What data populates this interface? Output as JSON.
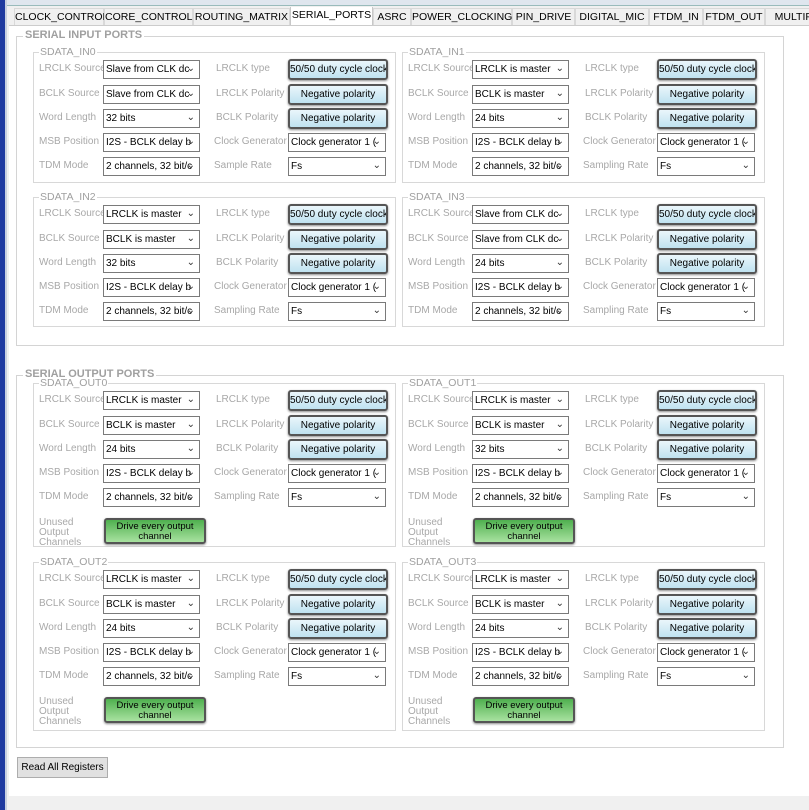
{
  "tabs": [
    "CLOCK_CONTROL",
    "CORE_CONTROL",
    "ROUTING_MATRIX",
    "SERIAL_PORTS",
    "ASRC",
    "POWER_CLOCKING",
    "PIN_DRIVE",
    "DIGITAL_MIC",
    "FTDM_IN",
    "FTDM_OUT",
    "MULTIPI"
  ],
  "active_tab": "SERIAL_PORTS",
  "labels": {
    "lrclk_source": "LRCLK Source",
    "bclk_source": "BCLK Source",
    "word_length": "Word Length",
    "msb_position": "MSB Position",
    "tdm_mode": "TDM Mode",
    "lrclk_type": "LRCLK type",
    "lrclk_polarity": "LRCLK Polarity",
    "bclk_polarity": "BCLK Polarity",
    "clock_generator": "Clock Generator",
    "unused_output": "Unused Output Channels"
  },
  "input_section": {
    "title": "SERIAL INPUT PORTS",
    "groups": [
      {
        "name": "SDATA_IN0",
        "lrclk_source": "Slave from CLK dc",
        "bclk_source": "Slave from CLK dc",
        "word_length": "32 bits",
        "msb_position": "I2S - BCLK delay b",
        "tdm_mode": "2 channels, 32 bit/c",
        "lrclk_type": "50/50 duty cycle clock",
        "lrclk_polarity": "Negative polarity",
        "bclk_polarity": "Negative polarity",
        "clock_generator": "Clock generator 1 (",
        "rate_label": "Sample Rate",
        "rate": "Fs"
      },
      {
        "name": "SDATA_IN1",
        "lrclk_source": "LRCLK is master",
        "bclk_source": "BCLK is master",
        "word_length": "24 bits",
        "msb_position": "I2S - BCLK delay b",
        "tdm_mode": "2 channels, 32 bit/c",
        "lrclk_type": "50/50 duty cycle clock",
        "lrclk_polarity": "Negative polarity",
        "bclk_polarity": "Negative polarity",
        "clock_generator": "Clock generator 1 (",
        "rate_label": "Sampling Rate",
        "rate": "Fs"
      },
      {
        "name": "SDATA_IN2",
        "lrclk_source": "LRCLK is master",
        "bclk_source": "BCLK is master",
        "word_length": "32 bits",
        "msb_position": "I2S - BCLK delay b",
        "tdm_mode": "2 channels, 32 bit/c",
        "lrclk_type": "50/50 duty cycle clock",
        "lrclk_polarity": "Negative polarity",
        "bclk_polarity": "Negative polarity",
        "clock_generator": "Clock generator 1 (",
        "rate_label": "Sampling Rate",
        "rate": "Fs"
      },
      {
        "name": "SDATA_IN3",
        "lrclk_source": "Slave from CLK dc",
        "bclk_source": "Slave from CLK dc",
        "word_length": "24 bits",
        "msb_position": "I2S - BCLK delay b",
        "tdm_mode": "2 channels, 32 bit/c",
        "lrclk_type": "50/50 duty cycle clock",
        "lrclk_polarity": "Negative polarity",
        "bclk_polarity": "Negative polarity",
        "clock_generator": "Clock generator 1 (",
        "rate_label": "Sampling Rate",
        "rate": "Fs"
      }
    ]
  },
  "output_section": {
    "title": "SERIAL OUTPUT PORTS",
    "groups": [
      {
        "name": "SDATA_OUT0",
        "lrclk_source": "LRCLK is master",
        "bclk_source": "BCLK is master",
        "word_length": "24 bits",
        "msb_position": "I2S - BCLK delay b",
        "tdm_mode": "2 channels, 32 bit/c",
        "lrclk_type": "50/50 duty cycle clock",
        "lrclk_polarity": "Negative polarity",
        "bclk_polarity": "Negative polarity",
        "clock_generator": "Clock generator 1 (",
        "rate_label": "Sampling Rate",
        "rate": "Fs",
        "unused_output": "Drive every output channel"
      },
      {
        "name": "SDATA_OUT1",
        "lrclk_source": "LRCLK is master",
        "bclk_source": "BCLK is master",
        "word_length": "32 bits",
        "msb_position": "I2S - BCLK delay b",
        "tdm_mode": "2 channels, 32 bit/c",
        "lrclk_type": "50/50 duty cycle clock",
        "lrclk_polarity": "Negative polarity",
        "bclk_polarity": "Negative polarity",
        "clock_generator": "Clock generator 1 (",
        "rate_label": "Sampling Rate",
        "rate": "Fs",
        "unused_output": "Drive every output channel"
      },
      {
        "name": "SDATA_OUT2",
        "lrclk_source": "LRCLK is master",
        "bclk_source": "BCLK is master",
        "word_length": "24 bits",
        "msb_position": "I2S - BCLK delay b",
        "tdm_mode": "2 channels, 32 bit/c",
        "lrclk_type": "50/50 duty cycle clock",
        "lrclk_polarity": "Negative polarity",
        "bclk_polarity": "Negative polarity",
        "clock_generator": "Clock generator 1 (",
        "rate_label": "Sampling Rate",
        "rate": "Fs",
        "unused_output": "Drive every output channel"
      },
      {
        "name": "SDATA_OUT3",
        "lrclk_source": "LRCLK is master",
        "bclk_source": "BCLK is master",
        "word_length": "24 bits",
        "msb_position": "I2S - BCLK delay b",
        "tdm_mode": "2 channels, 32 bit/c",
        "lrclk_type": "50/50 duty cycle clock",
        "lrclk_polarity": "Negative polarity",
        "bclk_polarity": "Negative polarity",
        "clock_generator": "Clock generator 1 (",
        "rate_label": "Sampling Rate",
        "rate": "Fs",
        "unused_output": "Drive every output channel"
      }
    ]
  },
  "read_all_label": "Read All Registers"
}
